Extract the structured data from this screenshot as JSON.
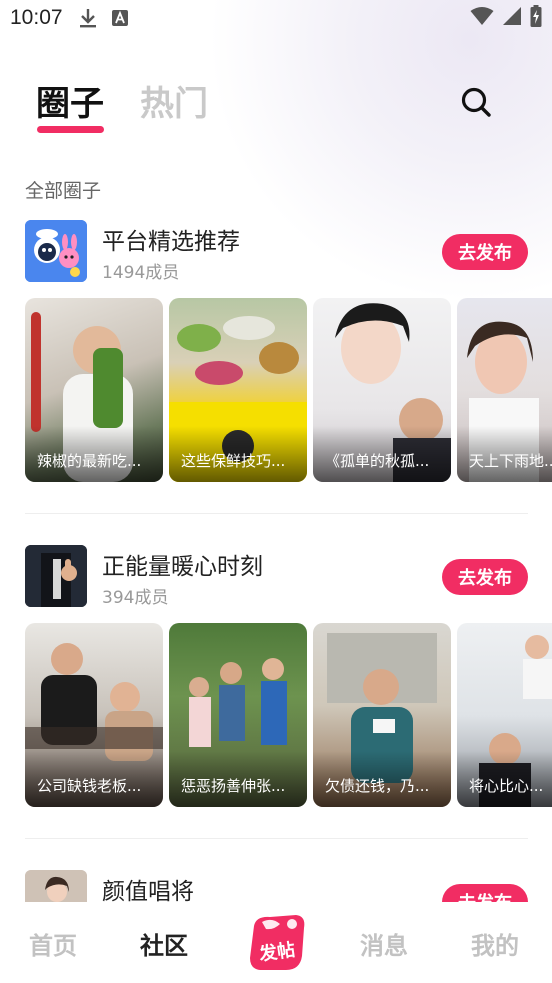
{
  "status_bar": {
    "time": "10:07"
  },
  "top_tabs": [
    {
      "label": "圈子",
      "active": true
    },
    {
      "label": "热门",
      "active": false
    }
  ],
  "section_label": "全部圈子",
  "circles": [
    {
      "name": "平台精选推荐",
      "members": "1494成员",
      "post_button": "去发布",
      "posts": [
        {
          "caption": "辣椒的最新吃..."
        },
        {
          "caption": "这些保鲜技巧..."
        },
        {
          "caption": "《孤单的秋孤..."
        },
        {
          "caption": "天上下雨地..."
        }
      ]
    },
    {
      "name": "正能量暖心时刻",
      "members": "394成员",
      "post_button": "去发布",
      "posts": [
        {
          "caption": "公司缺钱老板..."
        },
        {
          "caption": "惩恶扬善伸张..."
        },
        {
          "caption": "欠债还钱，乃..."
        },
        {
          "caption": "将心比心..."
        }
      ]
    },
    {
      "name": "颜值唱将",
      "post_button": "去发布"
    }
  ],
  "bottom_nav": {
    "home": "首页",
    "community": "社区",
    "publish": "发帖",
    "messages": "消息",
    "mine": "我的"
  },
  "colors": {
    "accent": "#f12d63"
  }
}
